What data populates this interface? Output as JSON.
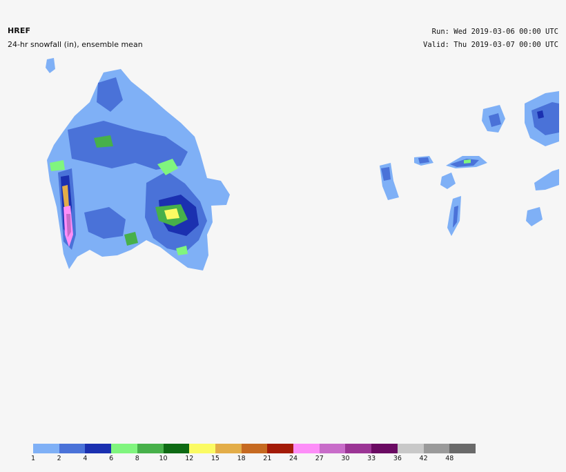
{
  "header": {
    "model": "HREF",
    "field": "24-hr snowfall (in), ensemble mean",
    "run": "Run: Wed 2019-03-06 00:00 UTC",
    "valid": "Valid: Thu 2019-03-07 00:00 UTC"
  },
  "legend": {
    "colors": [
      "#7fb0f6",
      "#4a72d8",
      "#1b30b0",
      "#80f57e",
      "#47b04a",
      "#0e6a14",
      "#fbfb63",
      "#e3ad48",
      "#c66a21",
      "#a31b08",
      "#fd8ef8",
      "#c86cc9",
      "#9b3595",
      "#6a0a62",
      "#c8c8c8",
      "#9a9a9a",
      "#6a6a6a"
    ],
    "ticks": [
      "1",
      "2",
      "4",
      "6",
      "8",
      "10",
      "12",
      "15",
      "18",
      "21",
      "24",
      "27",
      "30",
      "33",
      "36",
      "42",
      "48"
    ]
  }
}
